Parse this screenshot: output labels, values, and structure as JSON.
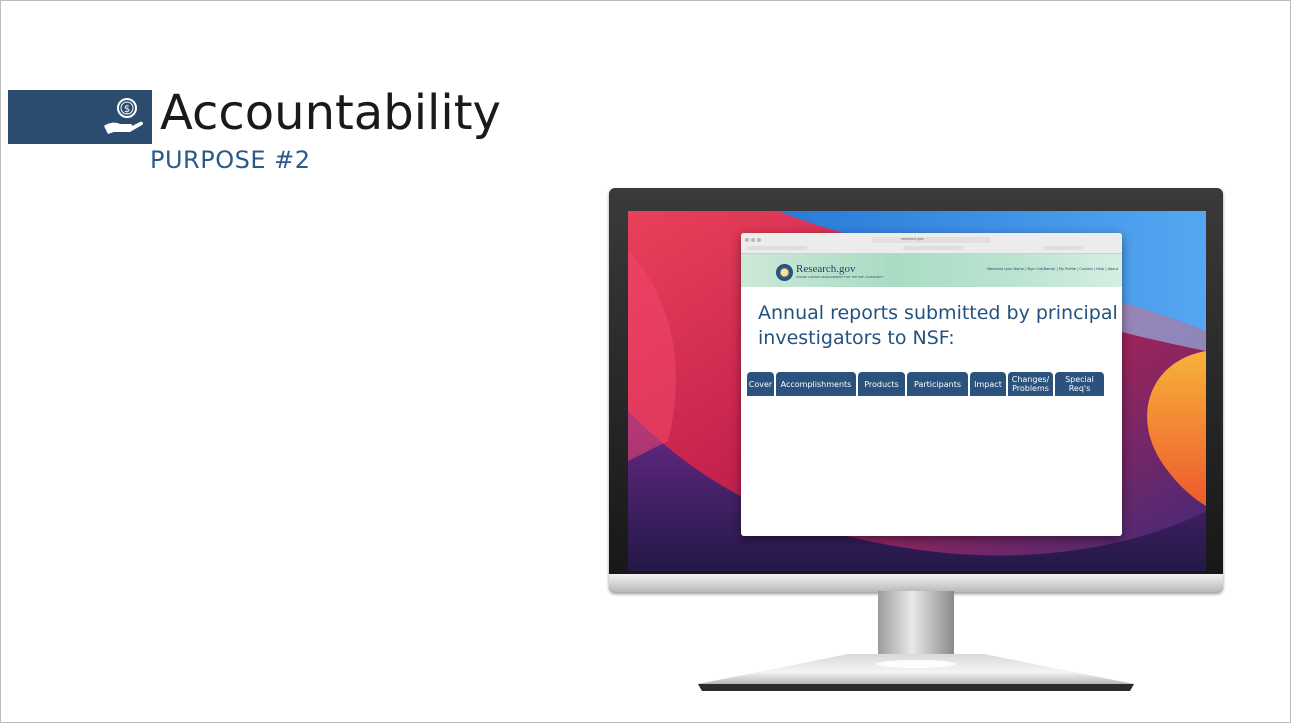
{
  "slide": {
    "title": "Accountability",
    "subtitle": "PURPOSE #2",
    "icon": "hand-holding-dollar-icon"
  },
  "browser": {
    "url": "research.gov",
    "site_logo": "Research.gov",
    "site_tagline": "ONLINE GRANTS MANAGEMENT FOR THE NSF COMMUNITY",
    "nav": "Welcome Lynn Name | Sign Out(Name) | My Profile | Contact | Help | About",
    "heading": "Annual reports submitted by principal investigators to NSF:",
    "tabs": [
      {
        "label": "Cover"
      },
      {
        "label": "Accomplishments"
      },
      {
        "label": "Products"
      },
      {
        "label": "Participants"
      },
      {
        "label": "Impact"
      },
      {
        "label": "Changes/ Problems"
      },
      {
        "label": "Special Req's"
      }
    ]
  },
  "colors": {
    "accent": "#2b4c6f",
    "tab_bg": "#2a527d",
    "heading_text": "#24527e",
    "subtitle_text": "#2b5a8a"
  }
}
